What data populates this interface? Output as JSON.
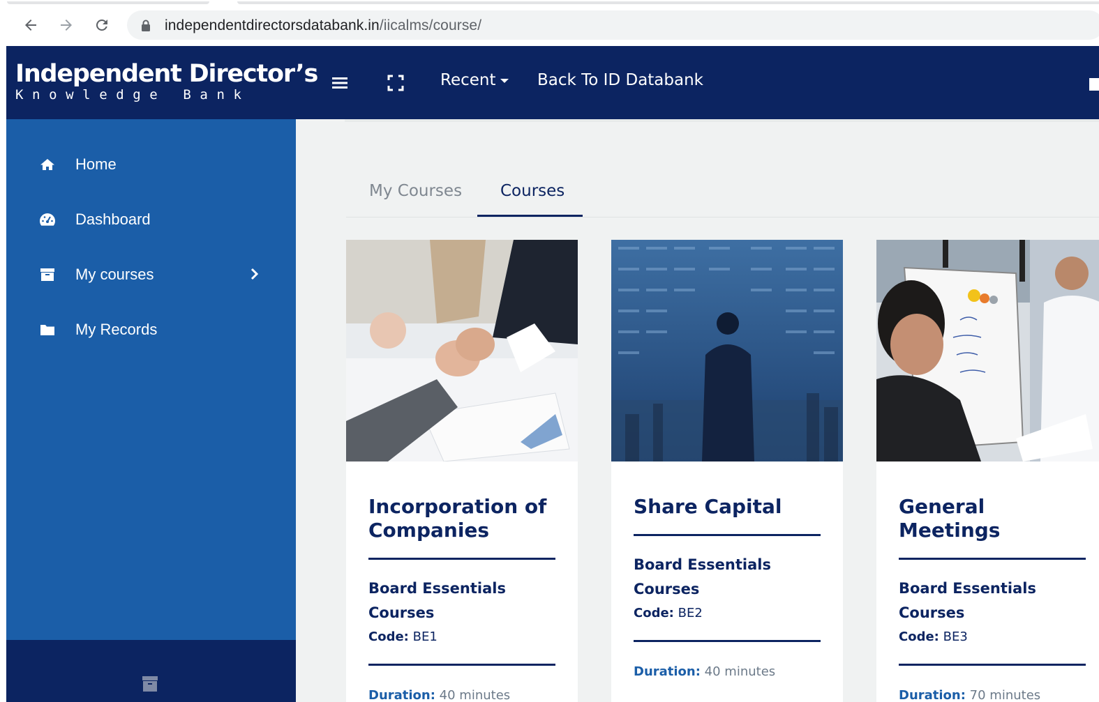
{
  "browser": {
    "url_host": "independentdirectorsdatabank.in",
    "url_path": "/iicalms/course/",
    "icons": [
      "back-arrow-icon",
      "forward-arrow-icon",
      "reload-icon",
      "lock-icon"
    ]
  },
  "header": {
    "logo_line1": "Independent Director’s",
    "logo_line2": "Knowledge Bank",
    "recent_label": "Recent",
    "back_label": "Back To ID Databank",
    "icons": [
      "menu-icon",
      "fullscreen-icon",
      "mail-icon"
    ],
    "bg_color": "#0c2461"
  },
  "sidebar": {
    "bg_color": "#1b5ea8",
    "items": [
      {
        "label": "Home",
        "icon": "home-icon"
      },
      {
        "label": "Dashboard",
        "icon": "dashboard-icon"
      },
      {
        "label": "My courses",
        "icon": "archive-icon"
      },
      {
        "label": "My Records",
        "icon": "folder-icon"
      }
    ]
  },
  "tabs": {
    "items": [
      "My Courses",
      "Courses"
    ],
    "active": "Courses"
  },
  "courses": [
    {
      "title": "Incorporation of Companies",
      "category": "Board Essentials Courses",
      "code_label": "Code:",
      "code": "BE1",
      "duration_label": "Duration:",
      "duration": "40 minutes"
    },
    {
      "title": "Share Capital",
      "category": "Board Essentials Courses",
      "code_label": "Code:",
      "code": "BE2",
      "duration_label": "Duration:",
      "duration": "40 minutes"
    },
    {
      "title": "General Meetings",
      "category": "Board Essentials Courses",
      "code_label": "Code:",
      "code": "BE3",
      "duration_label": "Duration:",
      "duration": "70 minutes"
    }
  ]
}
